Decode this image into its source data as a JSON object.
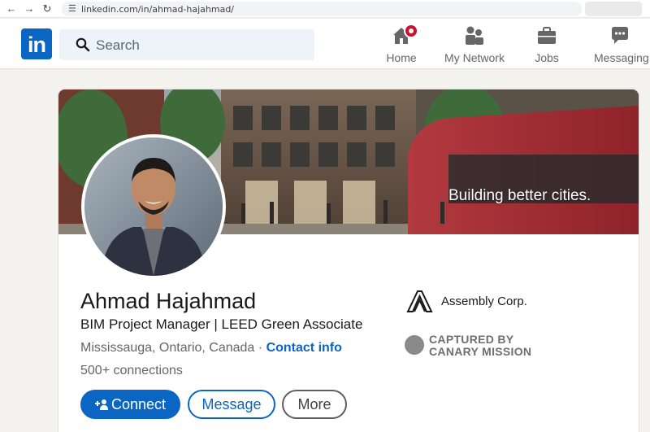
{
  "browser": {
    "url": "linkedin.com/in/ahmad-hajahmad/"
  },
  "header": {
    "logo_text": "in",
    "search_placeholder": "Search",
    "nav": [
      {
        "label": "Home",
        "icon": "home-icon"
      },
      {
        "label": "My Network",
        "icon": "people-icon"
      },
      {
        "label": "Jobs",
        "icon": "briefcase-icon"
      },
      {
        "label": "Messaging",
        "icon": "chat-icon"
      }
    ]
  },
  "profile": {
    "banner_text": "Building better cities.",
    "name": "Ahmad Hajahmad",
    "headline": "BIM Project Manager | LEED Green Associate",
    "location": "Mississauga, Ontario, Canada",
    "separator": "·",
    "contact_label": "Contact info",
    "connections": "500+ connections",
    "company": "Assembly Corp.",
    "buttons": {
      "connect": "Connect",
      "message": "Message",
      "more": "More"
    }
  },
  "watermark": {
    "line1": "CAPTURED BY",
    "line2": "CANARY MISSION"
  },
  "colors": {
    "brand_blue": "#0a66c2",
    "notification_red": "#cb112d",
    "page_bg": "#f3f2ef"
  }
}
